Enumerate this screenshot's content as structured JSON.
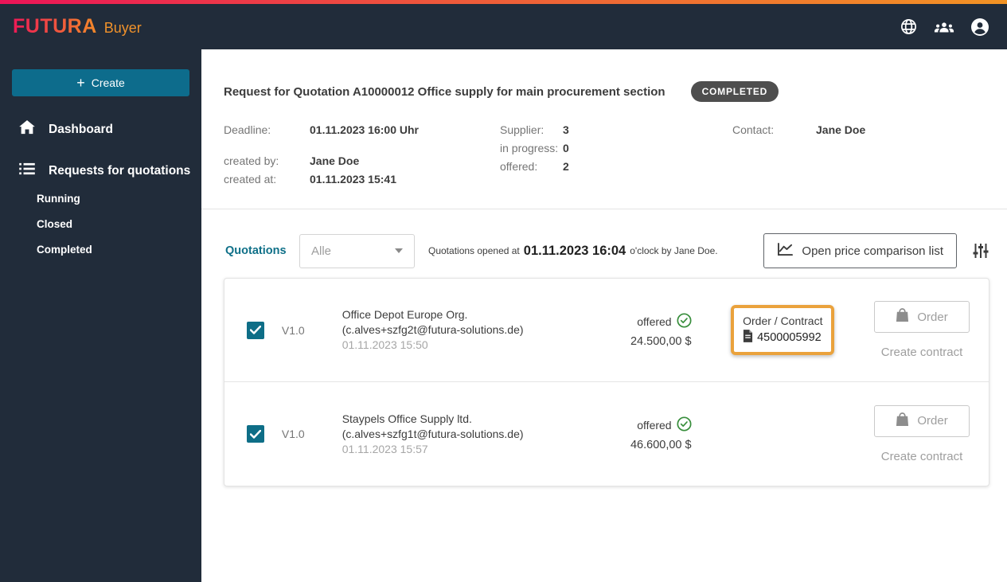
{
  "brand": {
    "name": "FUTURA",
    "product": "Buyer"
  },
  "topbar": {
    "icons": [
      "globe-icon",
      "team-icon",
      "account-icon"
    ]
  },
  "sidebar": {
    "create_button": {
      "plus": "+",
      "label": "Create"
    },
    "dashboard_label": "Dashboard",
    "requests_label": "Requests for quotations",
    "subitems": {
      "running": "Running",
      "closed": "Closed",
      "completed": "Completed"
    }
  },
  "header": {
    "title": "Request for Quotation A10000012 Office supply for main procurement section",
    "status_badge": "COMPLETED",
    "deadline_label": "Deadline:",
    "deadline": "01.11.2023 16:00 Uhr",
    "created_by_label": "created by:",
    "created_by": "Jane Doe",
    "created_at_label": "created at:",
    "created_at": "01.11.2023 15:41",
    "supplier_label": "Supplier:",
    "supplier_count": "3",
    "in_progress_label": "in progress:",
    "in_progress_count": "0",
    "offered_label": "offered:",
    "offered_count": "2",
    "contact_label": "Contact:",
    "contact": "Jane Doe"
  },
  "quotations": {
    "section_label": "Quotations",
    "filter_value": "Alle",
    "opened_prefix": "Quotations opened at",
    "opened_datetime": "01.11.2023 16:04",
    "opened_suffix": "o'clock by Jane Doe.",
    "compare_button_label": "Open price comparison list",
    "rows": [
      {
        "version": "V1.0",
        "supplier": "Office Depot Europe Org.",
        "email": "(c.alves+szfg2t@futura-solutions.de)",
        "submitted": "01.11.2023 15:50",
        "status": "offered",
        "price": "24.500,00 $",
        "order_contract_label": "Order / Contract",
        "order_contract_number": "4500005992",
        "order_label": "Order",
        "create_contract_label": "Create contract"
      },
      {
        "version": "V1.0",
        "supplier": "Staypels Office Supply ltd.",
        "email": "(c.alves+szfg1t@futura-solutions.de)",
        "submitted": "01.11.2023 15:57",
        "status": "offered",
        "price": "46.600,00 $",
        "order_label": "Order",
        "create_contract_label": "Create contract"
      }
    ]
  },
  "colors": {
    "navy": "#212c3a",
    "accent_teal": "#0e6e87",
    "highlight_orange": "#eaa23c",
    "success_green": "#388e3c",
    "badge_gray": "#4e4e4e"
  }
}
